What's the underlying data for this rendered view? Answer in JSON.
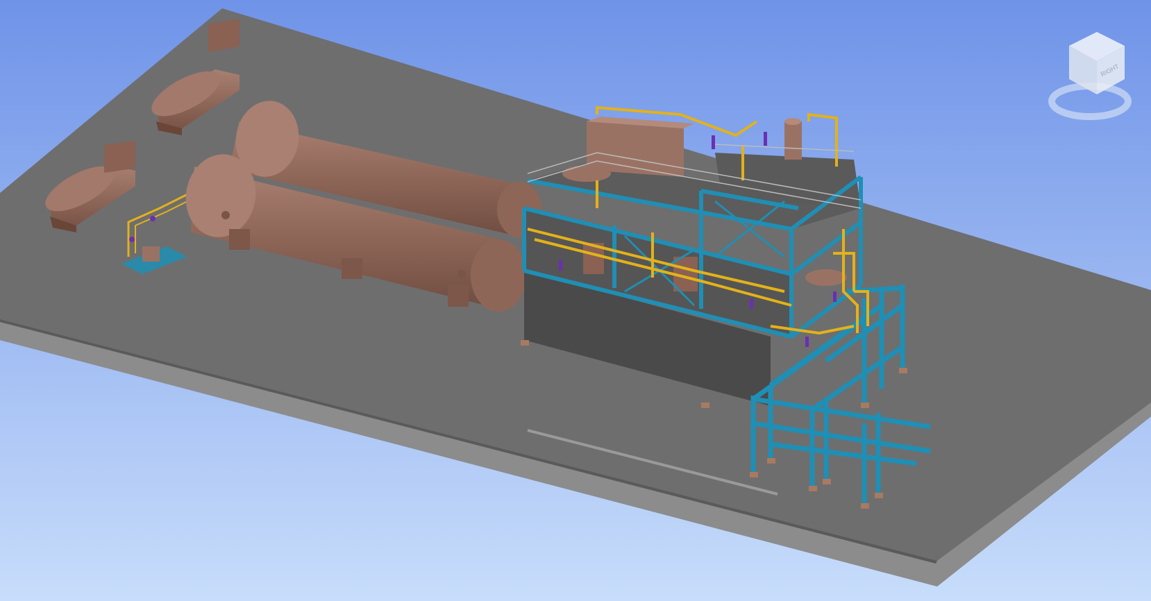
{
  "viewport": {
    "background": {
      "top": "#6f93e8",
      "bottom": "#c8ddfb"
    },
    "ground_color": "#6e6e6e",
    "ground_edge_color": "#8c8c8c",
    "equipment_color": "#9a7264",
    "steel_color": "#1f8fb5",
    "pipe_color": "#e3b21a",
    "valve_color": "#6a2fb3"
  },
  "viewcube": {
    "face_label": "RIGHT",
    "icon": "viewcube-icon",
    "compass_icon": "compass-ring-icon"
  }
}
